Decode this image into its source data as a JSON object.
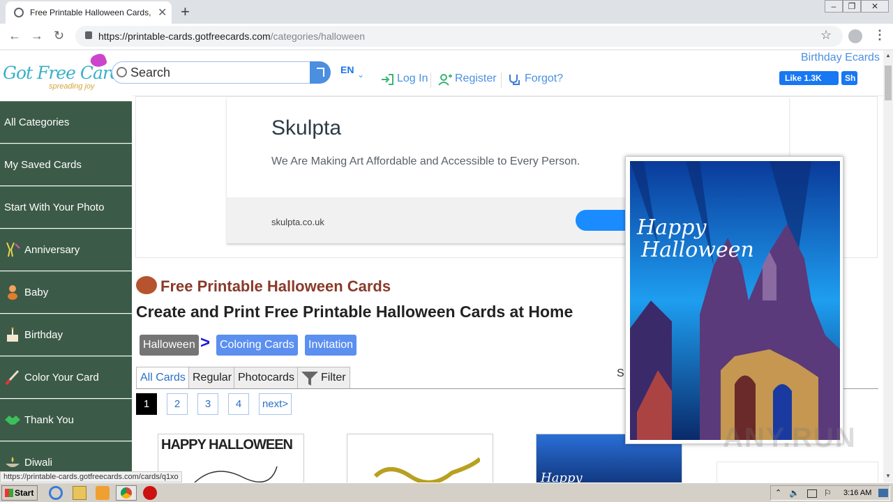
{
  "browser": {
    "tab_title": "Free Printable Halloween Cards, Cre",
    "url_host": "https://printable-cards.gotfreecards.com",
    "url_path": "/categories/halloween"
  },
  "header": {
    "logo_text": "Got Free Cards",
    "logo_tagline": "spreading joy",
    "search_placeholder": "Search",
    "lang": "EN",
    "login": "Log In",
    "register": "Register",
    "forgot": "Forgot?",
    "birthday_ecards": "Birthday Ecards",
    "fb_like": "Like 1.3K",
    "fb_share": "Sh"
  },
  "sidebar": {
    "items": [
      {
        "label": "All Categories"
      },
      {
        "label": "My Saved Cards"
      },
      {
        "label": "Start With Your Photo"
      },
      {
        "label": "Anniversary"
      },
      {
        "label": "Baby"
      },
      {
        "label": "Birthday"
      },
      {
        "label": "Color Your Card"
      },
      {
        "label": "Thank You"
      },
      {
        "label": "Diwali"
      }
    ]
  },
  "ad": {
    "title": "Skulpta",
    "description": "We Are Making Art Affordable and Accessible to Every Person.",
    "domain": "skulpta.co.uk"
  },
  "content": {
    "title": "Free Printable Halloween Cards",
    "subtitle": "Create and Print Free Printable Halloween Cards at Home",
    "breadcrumbs": [
      "Halloween",
      "Coloring Cards",
      "Invitation"
    ],
    "breadcrumb_sep": ">",
    "filter_tabs": [
      "All Cards",
      "Regular",
      "Photocards",
      "Filter"
    ],
    "sort_label": "S",
    "pages": [
      "1",
      "2",
      "3",
      "4",
      "next>"
    ],
    "thumb1_text": "HAPPY HALLOWEEN",
    "thumb3_text": "Happy"
  },
  "popup": {
    "card_text_line1": "Happy",
    "card_text_line2": "Halloween"
  },
  "status_url": "https://printable-cards.gotfreecards.com/cards/q1xo",
  "watermark": "ANY.RUN",
  "taskbar": {
    "start": "Start",
    "clock": "3:16 AM"
  },
  "colors": {
    "sidebar_bg": "#3c5a48",
    "accent_blue": "#4a90e2",
    "title_red": "#8a3a2a",
    "crumb_gray": "#757575",
    "crumb_blue": "#5b8ff0"
  }
}
